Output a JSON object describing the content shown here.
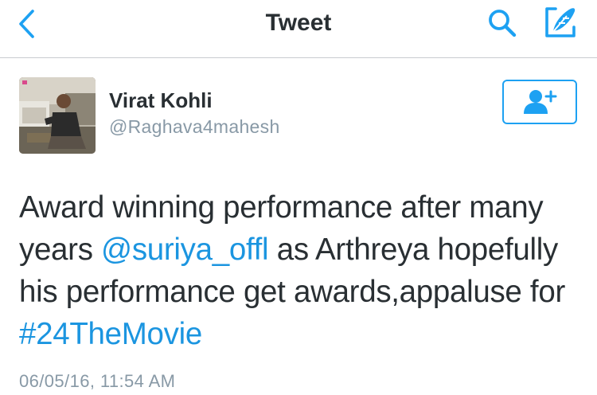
{
  "nav": {
    "title": "Tweet",
    "back_icon": "chevron-left-icon",
    "search_icon": "search-icon",
    "compose_icon": "compose-tweet-icon",
    "accent_color": "#1da1f2"
  },
  "author": {
    "display_name": "Virat Kohli",
    "handle": "@Raghava4mahesh",
    "follow_icon": "add-user-icon"
  },
  "tweet": {
    "line1": "Award winning performance after many",
    "line2_prefix": "years ",
    "mention": "@suriya_offl",
    "line2_suffix": " as Arthreya hopefully",
    "line3": "his performance get awards,appaluse for",
    "hashtag": "#24TheMovie",
    "timestamp": "06/05/16, 11:54 AM"
  },
  "colors": {
    "text": "#292f33",
    "link": "#1b95e0",
    "secondary": "#8899a6"
  }
}
